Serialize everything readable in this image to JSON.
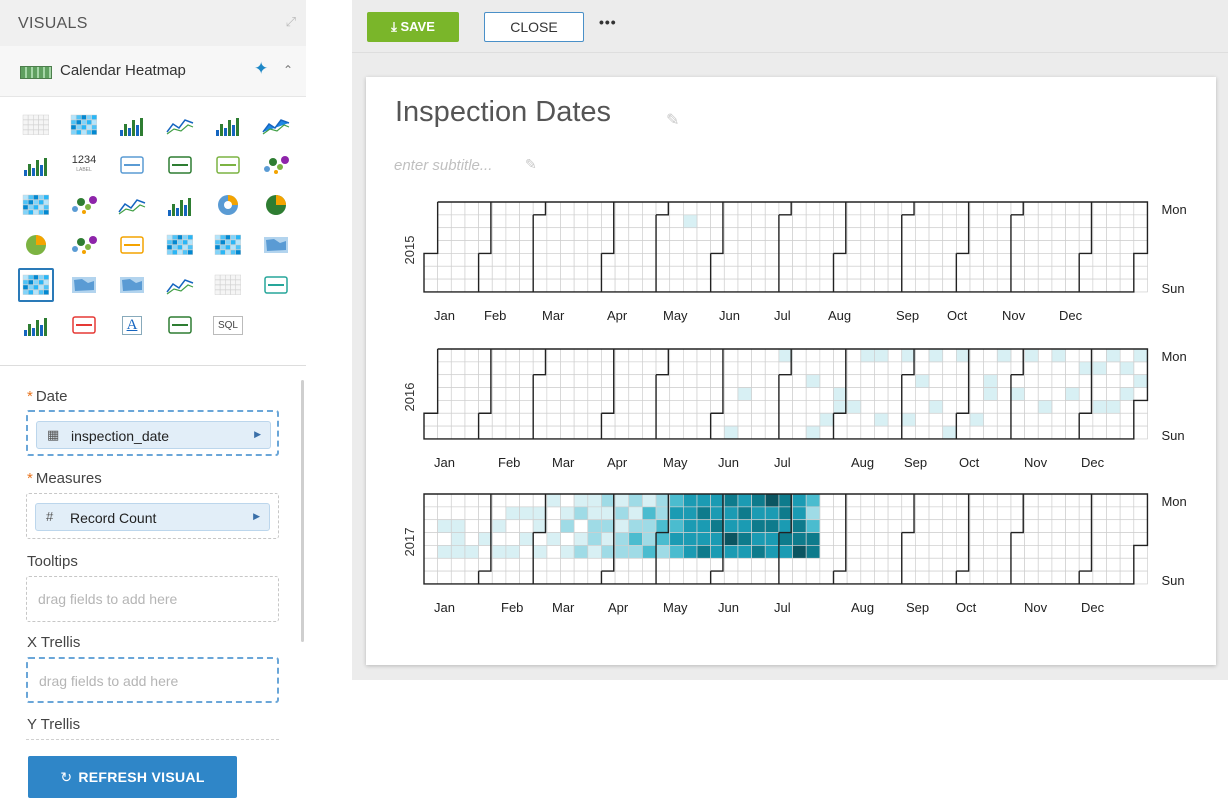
{
  "left_panel": {
    "title": "VISUALS",
    "visual_type": {
      "label": "Calendar Heatmap"
    },
    "icons": [
      [
        "table-icon",
        "cross-tab-icon",
        "bar-chart-icon",
        "line-chart-icon",
        "combo-bar-line-icon",
        "area-chart-icon"
      ],
      [
        "grouped-bars-icon",
        "kpi-icon",
        "gauge-icon",
        "bullet-chart-icon",
        "box-plot-icon",
        "packed-bubbles-icon"
      ],
      [
        "correlation-heatmap-icon",
        "scatter-icon",
        "lines-icon",
        "horizontal-bars-icon",
        "donut-icon",
        "radial-icon"
      ],
      [
        "pie-icon",
        "network-icon",
        "funnel-icon",
        "treemap-icon",
        "heatmap-icon",
        "map-marker-icon"
      ],
      [
        "calendar-heatmap-icon",
        "choropleth-icon",
        "interactive-map-icon",
        "sparklines-icon",
        "rich-text-table-icon",
        "chord-icon"
      ],
      [
        "histogram-icon",
        "extension-icon",
        "rich-text-icon",
        "field-statistics-icon",
        "sql-icon"
      ]
    ],
    "kpi_text": "1234",
    "kpi_sub": "LABEL",
    "sql_text": "SQL",
    "rich_text_letter": "A",
    "shelves": {
      "date": {
        "label": "Date",
        "field": "inspection_date"
      },
      "measures": {
        "label": "Measures",
        "field": "Record Count"
      },
      "tooltips": {
        "label": "Tooltips",
        "placeholder": "drag fields to add here"
      },
      "x_trellis": {
        "label": "X Trellis",
        "placeholder": "drag fields to add here"
      },
      "y_trellis": {
        "label": "Y Trellis"
      }
    },
    "refresh_button": "REFRESH VISUAL"
  },
  "toolbar": {
    "save_label": "SAVE",
    "close_label": "CLOSE",
    "more_label": "•••"
  },
  "visual": {
    "title": "Inspection Dates",
    "subtitle_placeholder": "enter subtitle..."
  },
  "chart_data": {
    "type": "heatmap",
    "subtype": "calendar",
    "title": "Inspection Dates",
    "years": [
      "2015",
      "2016",
      "2017"
    ],
    "months": [
      "Jan",
      "Feb",
      "Mar",
      "Apr",
      "May",
      "Jun",
      "Jul",
      "Aug",
      "Sep",
      "Oct",
      "Nov",
      "Dec"
    ],
    "day_labels": {
      "top": "Mon",
      "bottom": "Sun"
    },
    "measure": "Record Count",
    "grid": true,
    "color_scale": [
      "#ffffff",
      "#d8f0f4",
      "#9fdbe6",
      "#4bbccf",
      "#1b9bb3",
      "#0e7b8c",
      "#0b5561"
    ],
    "cells": {
      "2015": [
        {
          "week": 19,
          "day": 1,
          "level": 1
        }
      ],
      "2016": [
        {
          "week": 26,
          "day": 0,
          "level": 1
        },
        {
          "week": 23,
          "day": 3,
          "level": 1
        },
        {
          "week": 22,
          "day": 6,
          "level": 1
        },
        {
          "week": 28,
          "day": 2,
          "level": 1
        },
        {
          "week": 28,
          "day": 6,
          "level": 1
        },
        {
          "week": 29,
          "day": 5,
          "level": 1
        },
        {
          "week": 30,
          "day": 3,
          "level": 1
        },
        {
          "week": 30,
          "day": 4,
          "level": 1
        },
        {
          "week": 31,
          "day": 4,
          "level": 1
        },
        {
          "week": 32,
          "day": 0,
          "level": 1
        },
        {
          "week": 33,
          "day": 0,
          "level": 1
        },
        {
          "week": 33,
          "day": 5,
          "level": 1
        },
        {
          "week": 35,
          "day": 0,
          "level": 1
        },
        {
          "week": 35,
          "day": 5,
          "level": 1
        },
        {
          "week": 36,
          "day": 2,
          "level": 1
        },
        {
          "week": 37,
          "day": 4,
          "level": 1
        },
        {
          "week": 37,
          "day": 0,
          "level": 1
        },
        {
          "week": 38,
          "day": 6,
          "level": 1
        },
        {
          "week": 39,
          "day": 0,
          "level": 1
        },
        {
          "week": 40,
          "day": 5,
          "level": 1
        },
        {
          "week": 41,
          "day": 2,
          "level": 1
        },
        {
          "week": 41,
          "day": 3,
          "level": 1
        },
        {
          "week": 42,
          "day": 0,
          "level": 1
        },
        {
          "week": 43,
          "day": 3,
          "level": 1
        },
        {
          "week": 44,
          "day": 0,
          "level": 1
        },
        {
          "week": 45,
          "day": 4,
          "level": 1
        },
        {
          "week": 46,
          "day": 0,
          "level": 1
        },
        {
          "week": 47,
          "day": 3,
          "level": 1
        },
        {
          "week": 48,
          "day": 1,
          "level": 1
        },
        {
          "week": 49,
          "day": 1,
          "level": 1
        },
        {
          "week": 49,
          "day": 4,
          "level": 1
        },
        {
          "week": 50,
          "day": 0,
          "level": 1
        },
        {
          "week": 50,
          "day": 4,
          "level": 1
        },
        {
          "week": 51,
          "day": 1,
          "level": 1
        },
        {
          "week": 51,
          "day": 3,
          "level": 1
        },
        {
          "week": 52,
          "day": 0,
          "level": 1
        },
        {
          "week": 52,
          "day": 2,
          "level": 1
        }
      ],
      "2017": [
        {
          "week": 1,
          "day": 2,
          "level": 1
        },
        {
          "week": 1,
          "day": 4,
          "level": 1
        },
        {
          "week": 2,
          "day": 2,
          "level": 1
        },
        {
          "week": 2,
          "day": 3,
          "level": 1
        },
        {
          "week": 2,
          "day": 4,
          "level": 1
        },
        {
          "week": 3,
          "day": 4,
          "level": 1
        },
        {
          "week": 4,
          "day": 3,
          "level": 1
        },
        {
          "week": 5,
          "day": 2,
          "level": 1
        },
        {
          "week": 5,
          "day": 4,
          "level": 1
        },
        {
          "week": 6,
          "day": 1,
          "level": 1
        },
        {
          "week": 6,
          "day": 4,
          "level": 1
        },
        {
          "week": 7,
          "day": 1,
          "level": 1
        },
        {
          "week": 7,
          "day": 3,
          "level": 1
        },
        {
          "week": 8,
          "day": 1,
          "level": 1
        },
        {
          "week": 8,
          "day": 2,
          "level": 1
        },
        {
          "week": 8,
          "day": 4,
          "level": 1
        },
        {
          "week": 9,
          "day": 0,
          "level": 1
        },
        {
          "week": 9,
          "day": 3,
          "level": 1
        },
        {
          "week": 10,
          "day": 1,
          "level": 1
        },
        {
          "week": 10,
          "day": 2,
          "level": 2
        },
        {
          "week": 10,
          "day": 4,
          "level": 1
        },
        {
          "week": 11,
          "day": 0,
          "level": 1
        },
        {
          "week": 11,
          "day": 1,
          "level": 2
        },
        {
          "week": 11,
          "day": 3,
          "level": 1
        },
        {
          "week": 11,
          "day": 4,
          "level": 2
        },
        {
          "week": 12,
          "day": 0,
          "level": 1
        },
        {
          "week": 12,
          "day": 1,
          "level": 1
        },
        {
          "week": 12,
          "day": 2,
          "level": 2
        },
        {
          "week": 12,
          "day": 3,
          "level": 2
        },
        {
          "week": 12,
          "day": 4,
          "level": 1
        },
        {
          "week": 13,
          "day": 0,
          "level": 2
        },
        {
          "week": 13,
          "day": 1,
          "level": 1
        },
        {
          "week": 13,
          "day": 2,
          "level": 2
        },
        {
          "week": 13,
          "day": 3,
          "level": 1
        },
        {
          "week": 13,
          "day": 4,
          "level": 2
        },
        {
          "week": 14,
          "day": 0,
          "level": 1
        },
        {
          "week": 14,
          "day": 1,
          "level": 2
        },
        {
          "week": 14,
          "day": 2,
          "level": 1
        },
        {
          "week": 14,
          "day": 3,
          "level": 2
        },
        {
          "week": 14,
          "day": 4,
          "level": 2
        },
        {
          "week": 15,
          "day": 0,
          "level": 2
        },
        {
          "week": 15,
          "day": 1,
          "level": 1
        },
        {
          "week": 15,
          "day": 2,
          "level": 2
        },
        {
          "week": 15,
          "day": 3,
          "level": 3
        },
        {
          "week": 15,
          "day": 4,
          "level": 2
        },
        {
          "week": 16,
          "day": 0,
          "level": 1
        },
        {
          "week": 16,
          "day": 1,
          "level": 3
        },
        {
          "week": 16,
          "day": 2,
          "level": 2
        },
        {
          "week": 16,
          "day": 3,
          "level": 2
        },
        {
          "week": 16,
          "day": 4,
          "level": 3
        },
        {
          "week": 17,
          "day": 0,
          "level": 2
        },
        {
          "week": 17,
          "day": 1,
          "level": 2
        },
        {
          "week": 17,
          "day": 2,
          "level": 3
        },
        {
          "week": 17,
          "day": 3,
          "level": 3
        },
        {
          "week": 17,
          "day": 4,
          "level": 2
        },
        {
          "week": 18,
          "day": 0,
          "level": 3
        },
        {
          "week": 18,
          "day": 1,
          "level": 4
        },
        {
          "week": 18,
          "day": 2,
          "level": 3
        },
        {
          "week": 18,
          "day": 3,
          "level": 4
        },
        {
          "week": 18,
          "day": 4,
          "level": 3
        },
        {
          "week": 19,
          "day": 0,
          "level": 4
        },
        {
          "week": 19,
          "day": 1,
          "level": 4
        },
        {
          "week": 19,
          "day": 2,
          "level": 4
        },
        {
          "week": 19,
          "day": 3,
          "level": 4
        },
        {
          "week": 19,
          "day": 4,
          "level": 4
        },
        {
          "week": 20,
          "day": 0,
          "level": 4
        },
        {
          "week": 20,
          "day": 1,
          "level": 5
        },
        {
          "week": 20,
          "day": 2,
          "level": 4
        },
        {
          "week": 20,
          "day": 3,
          "level": 4
        },
        {
          "week": 20,
          "day": 4,
          "level": 5
        },
        {
          "week": 21,
          "day": 0,
          "level": 4
        },
        {
          "week": 21,
          "day": 1,
          "level": 4
        },
        {
          "week": 21,
          "day": 2,
          "level": 5
        },
        {
          "week": 21,
          "day": 3,
          "level": 4
        },
        {
          "week": 21,
          "day": 4,
          "level": 4
        },
        {
          "week": 22,
          "day": 0,
          "level": 5
        },
        {
          "week": 22,
          "day": 1,
          "level": 4
        },
        {
          "week": 22,
          "day": 2,
          "level": 4
        },
        {
          "week": 22,
          "day": 3,
          "level": 6
        },
        {
          "week": 22,
          "day": 4,
          "level": 4
        },
        {
          "week": 23,
          "day": 0,
          "level": 4
        },
        {
          "week": 23,
          "day": 1,
          "level": 5
        },
        {
          "week": 23,
          "day": 2,
          "level": 4
        },
        {
          "week": 23,
          "day": 3,
          "level": 5
        },
        {
          "week": 23,
          "day": 4,
          "level": 4
        },
        {
          "week": 24,
          "day": 0,
          "level": 5
        },
        {
          "week": 24,
          "day": 1,
          "level": 4
        },
        {
          "week": 24,
          "day": 2,
          "level": 5
        },
        {
          "week": 24,
          "day": 3,
          "level": 4
        },
        {
          "week": 24,
          "day": 4,
          "level": 5
        },
        {
          "week": 25,
          "day": 0,
          "level": 6
        },
        {
          "week": 25,
          "day": 1,
          "level": 4
        },
        {
          "week": 25,
          "day": 2,
          "level": 5
        },
        {
          "week": 25,
          "day": 3,
          "level": 4
        },
        {
          "week": 25,
          "day": 4,
          "level": 4
        },
        {
          "week": 26,
          "day": 0,
          "level": 5
        },
        {
          "week": 26,
          "day": 1,
          "level": 5
        },
        {
          "week": 26,
          "day": 2,
          "level": 4
        },
        {
          "week": 26,
          "day": 3,
          "level": 5
        },
        {
          "week": 26,
          "day": 4,
          "level": 4
        },
        {
          "week": 27,
          "day": 0,
          "level": 4
        },
        {
          "week": 27,
          "day": 1,
          "level": 4
        },
        {
          "week": 27,
          "day": 2,
          "level": 5
        },
        {
          "week": 27,
          "day": 3,
          "level": 5
        },
        {
          "week": 27,
          "day": 4,
          "level": 6
        },
        {
          "week": 28,
          "day": 0,
          "level": 3
        },
        {
          "week": 28,
          "day": 1,
          "level": 2
        },
        {
          "week": 28,
          "day": 2,
          "level": 3
        },
        {
          "week": 28,
          "day": 3,
          "level": 5
        },
        {
          "week": 28,
          "day": 4,
          "level": 5
        }
      ]
    }
  }
}
